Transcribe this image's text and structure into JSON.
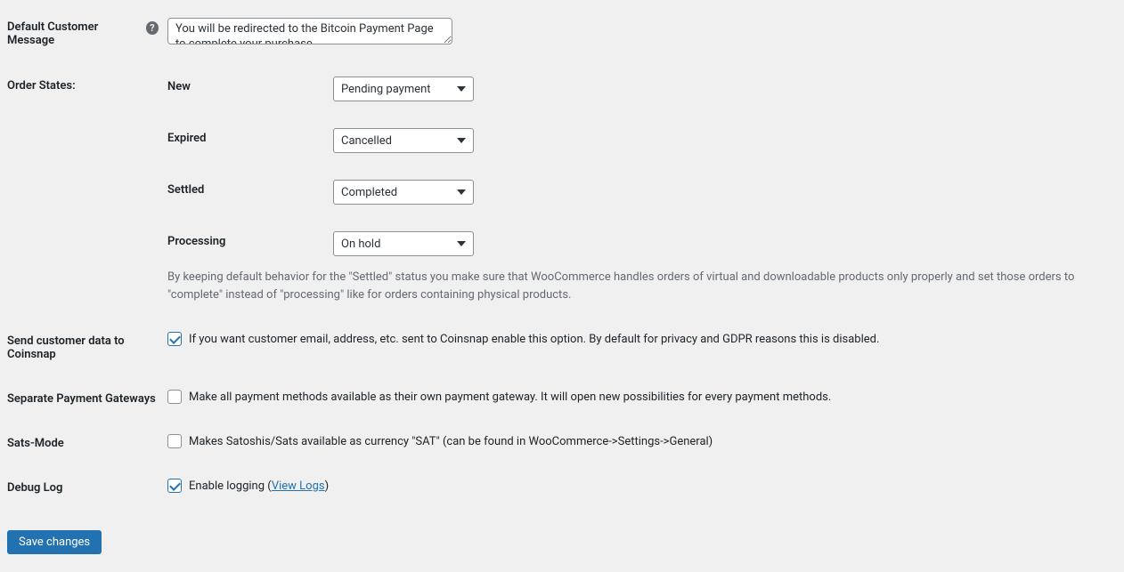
{
  "defaultCustomerMessage": {
    "label": "Default Customer Message",
    "value": "You will be redirected to the Bitcoin Payment Page to complete your purchase"
  },
  "orderStates": {
    "label": "Order States:",
    "rows": [
      {
        "label": "New",
        "value": "Pending payment"
      },
      {
        "label": "Expired",
        "value": "Cancelled"
      },
      {
        "label": "Settled",
        "value": "Completed"
      },
      {
        "label": "Processing",
        "value": "On hold"
      }
    ],
    "description": "By keeping default behavior for the \"Settled\" status you make sure that WooCommerce handles orders of virtual and downloadable products only properly and set those orders to \"complete\" instead of \"processing\" like for orders containing physical products."
  },
  "sendCustomerData": {
    "label": "Send customer data to Coinsnap",
    "checked": true,
    "text": "If you want customer email, address, etc. sent to Coinsnap enable this option. By default for privacy and GDPR reasons this is disabled."
  },
  "separateGateways": {
    "label": "Separate Payment Gateways",
    "checked": false,
    "text": "Make all payment methods available as their own payment gateway. It will open new possibilities for every payment methods."
  },
  "satsMode": {
    "label": "Sats-Mode",
    "checked": false,
    "text": "Makes Satoshis/Sats available as currency \"SAT\" (can be found in WooCommerce->Settings->General)"
  },
  "debugLog": {
    "label": "Debug Log",
    "checked": true,
    "textPre": "Enable logging (",
    "link": "View Logs",
    "textPost": ")"
  },
  "submit": {
    "label": "Save changes"
  }
}
